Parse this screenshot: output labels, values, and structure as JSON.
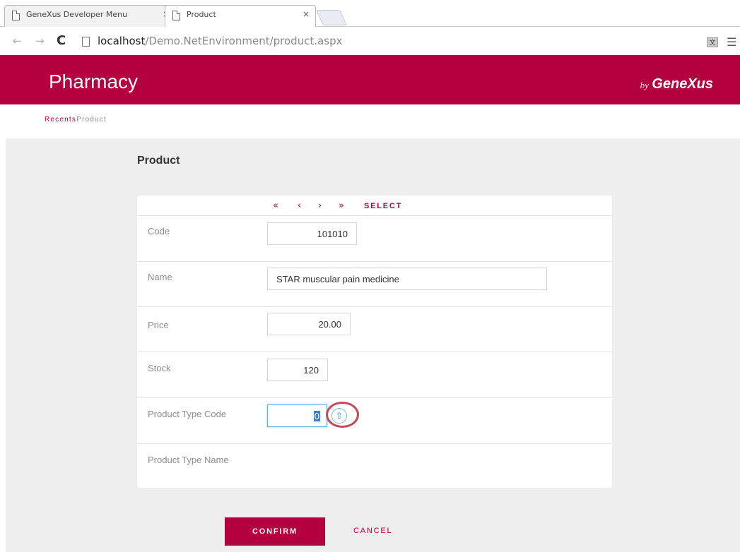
{
  "browser": {
    "tabs": [
      {
        "title": "GeneXus Developer Menu",
        "close": "×"
      },
      {
        "title": "Product",
        "close": "×"
      }
    ],
    "url_host": "localhost",
    "url_path": "/Demo.NetEnvironment/product.aspx",
    "icons": [
      "back-icon",
      "forward-icon",
      "reload-icon",
      "page-icon",
      "translate-icon",
      "menu-icon"
    ]
  },
  "header": {
    "app_title": "Pharmacy",
    "brand_by": "by",
    "brand_name": "GeneXus",
    "color": "#b4003e"
  },
  "breadcrumb": {
    "first": "Recents",
    "second": "Product"
  },
  "page": {
    "title": "Product"
  },
  "pager": {
    "first": "«",
    "prev": "‹",
    "next": "›",
    "last": "»",
    "select": "SELECT"
  },
  "form": {
    "code": {
      "label": "Code",
      "value": "101010"
    },
    "name": {
      "label": "Name",
      "value": "STAR muscular pain medicine"
    },
    "price": {
      "label": "Price",
      "value": "20.00"
    },
    "stock": {
      "label": "Stock",
      "value": "120"
    },
    "product_type_code": {
      "label": "Product Type Code",
      "value": "0"
    },
    "product_type_name": {
      "label": "Product Type Name",
      "value": ""
    }
  },
  "actions": {
    "confirm": "CONFIRM",
    "cancel": "CANCEL"
  }
}
